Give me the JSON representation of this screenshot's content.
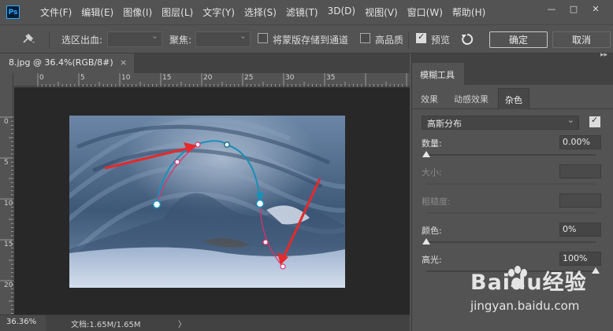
{
  "app": {
    "logo": "Ps"
  },
  "menu": [
    "文件(F)",
    "编辑(E)",
    "图像(I)",
    "图层(L)",
    "文字(Y)",
    "选择(S)",
    "滤镜(T)",
    "3D(D)",
    "视图(V)",
    "窗口(W)",
    "帮助(H)"
  ],
  "window_controls": {
    "minimize": "—",
    "maximize": "□",
    "close": "✕"
  },
  "options": {
    "selection_bleed_label": "选区出血:",
    "focus_label": "聚焦:",
    "store_mask_label": "将蒙版存储到通道",
    "high_quality_label": "高品质",
    "preview_label": "预览",
    "preview_checked": true,
    "ok_label": "确定",
    "cancel_label": "取消"
  },
  "document": {
    "tab_title": "8.jpg @ 36.4%(RGB/8#)",
    "tab_close": "×",
    "ruler_h_labels": [
      "0",
      "5",
      "10",
      "15",
      "20",
      "25",
      "30",
      "35"
    ],
    "ruler_v_labels": [
      "0",
      "5",
      "10",
      "15",
      "20"
    ]
  },
  "status": {
    "zoom": "36.36%",
    "doc_size": "文档:1.65M/1.65M",
    "arrow": "〉"
  },
  "panel": {
    "title": "模糊工具",
    "tabs": [
      "效果",
      "动感效果",
      "杂色"
    ],
    "active_tab": "杂色",
    "distribution": "高斯分布",
    "distribution_checked": true,
    "amount_label": "数量:",
    "amount_value": "0.00%",
    "size_label": "大小:",
    "roughness_label": "粗糙度:",
    "color_label": "颜色:",
    "color_value": "0%",
    "highlight_label": "高光:",
    "highlight_value": "100%"
  },
  "watermark": {
    "brand": "Baidu经验",
    "url": "jingyan.baidu.com"
  },
  "colors": {
    "path": "#1a8fb8",
    "path_red": "#e0306a",
    "arrow_red": "#e42a2a",
    "panel_bg": "#535353",
    "canvas_bg": "#282828"
  }
}
